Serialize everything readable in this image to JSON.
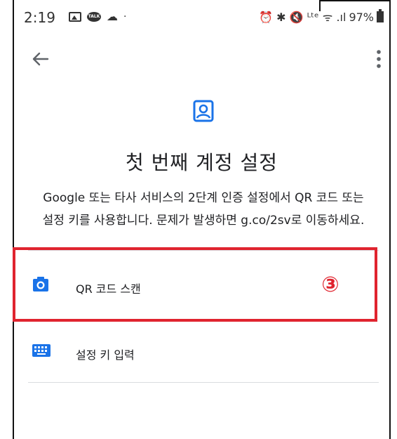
{
  "status_bar": {
    "time": "2:19",
    "right_text": "⏰ ✱ 🔇 ᴸᵗᵉ ᯤ .ıl",
    "battery": "97%"
  },
  "app_bar": {
    "back_icon": "arrow-left-icon",
    "menu_icon": "more-vertical-icon"
  },
  "main": {
    "title": "첫 번째 계정 설정",
    "description_line1": "Google 또는 타사 서비스의 2단계 인증 설정에서 QR 코드 또는",
    "description_line2": "설정 키를 사용합니다. 문제가 발생하면 g.co/2sv로 이동하세요.",
    "options": [
      {
        "label": "QR 코드 스캔",
        "icon": "camera-icon"
      },
      {
        "label": "설정 키 입력",
        "icon": "keyboard-icon"
      }
    ]
  },
  "annotation": {
    "badge": "③",
    "color": "#e0242f"
  },
  "colors": {
    "accent": "#1a73e8",
    "text": "#202124",
    "divider": "#dadce0"
  }
}
